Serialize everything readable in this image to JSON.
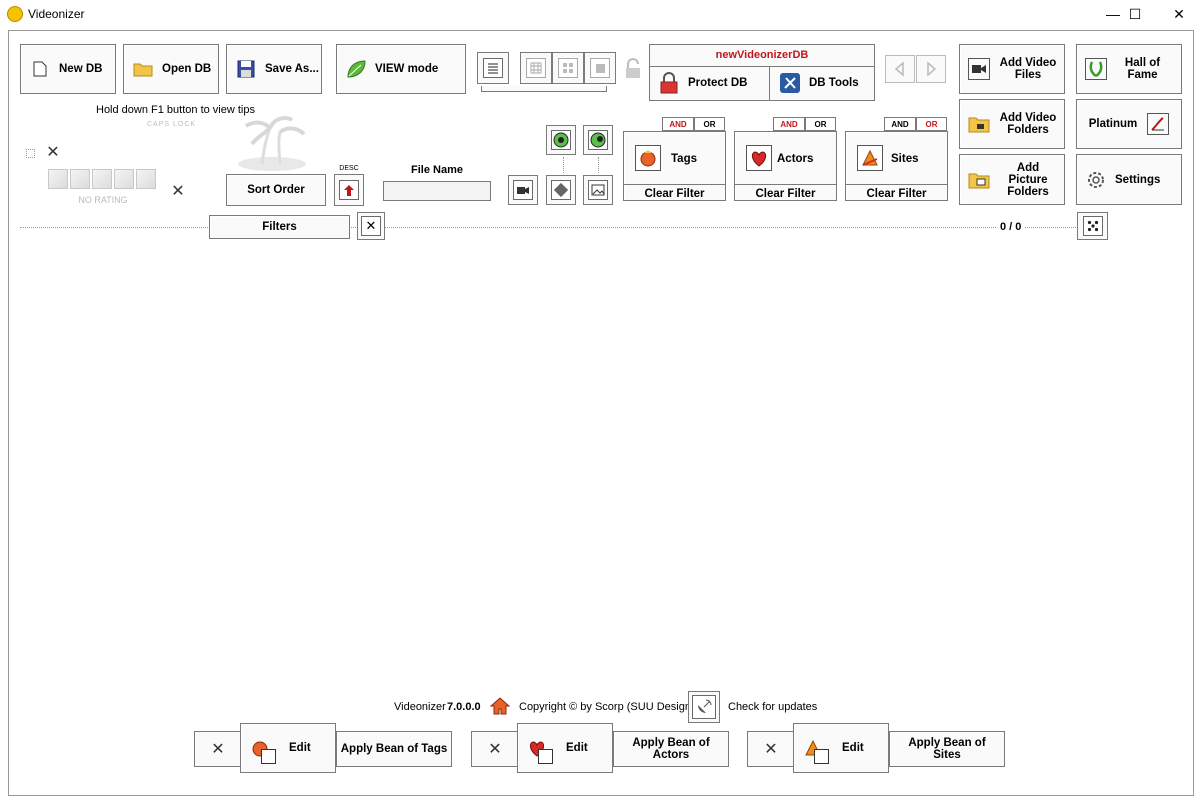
{
  "window": {
    "title": "Videonizer",
    "minimize": "—",
    "maximize": "☐",
    "close": "✕"
  },
  "toolbar": {
    "new_db": "New DB",
    "open_db": "Open DB",
    "save_as": "Save As...",
    "view_mode": "VIEW mode",
    "db_name": "newVideonizerDB",
    "protect_db": "Protect DB",
    "db_tools": "DB Tools",
    "add_video_files": "Add Video Files",
    "add_video_folders": "Add Video Folders",
    "add_picture_folders": "Add Picture Folders",
    "hall_of_fame": "Hall of Fame",
    "platinum": "Platinum",
    "settings": "Settings"
  },
  "tips": {
    "f1": "Hold down F1 button to view tips",
    "caps": "CAPS LOCK"
  },
  "rating": {
    "label": "NO RATING"
  },
  "sort": {
    "order_label": "Sort Order",
    "direction": "DESC",
    "file_name_label": "File Name",
    "file_name_value": ""
  },
  "filter_groups": [
    {
      "name": "Tags",
      "clear": "Clear Filter",
      "and": "AND",
      "or": "OR",
      "active": "AND"
    },
    {
      "name": "Actors",
      "clear": "Clear Filter",
      "and": "AND",
      "or": "OR",
      "active": "AND"
    },
    {
      "name": "Sites",
      "clear": "Clear Filter",
      "and": "AND",
      "or": "OR",
      "active": "OR"
    }
  ],
  "filters": {
    "label": "Filters",
    "count": "0 / 0"
  },
  "footer": {
    "app": "Videonizer",
    "version": "7.0.0.0",
    "copyright": "Copyright © by Scorp (SUU Design)",
    "check_updates": "Check for updates"
  },
  "bottom_bar": [
    {
      "edit": "Edit",
      "apply": "Apply Bean of Tags"
    },
    {
      "edit": "Edit",
      "apply": "Apply Bean of Actors"
    },
    {
      "edit": "Edit",
      "apply": "Apply Bean of Sites"
    }
  ],
  "colors": {
    "accent_red": "#c0161b",
    "border": "#7a7a7a"
  }
}
